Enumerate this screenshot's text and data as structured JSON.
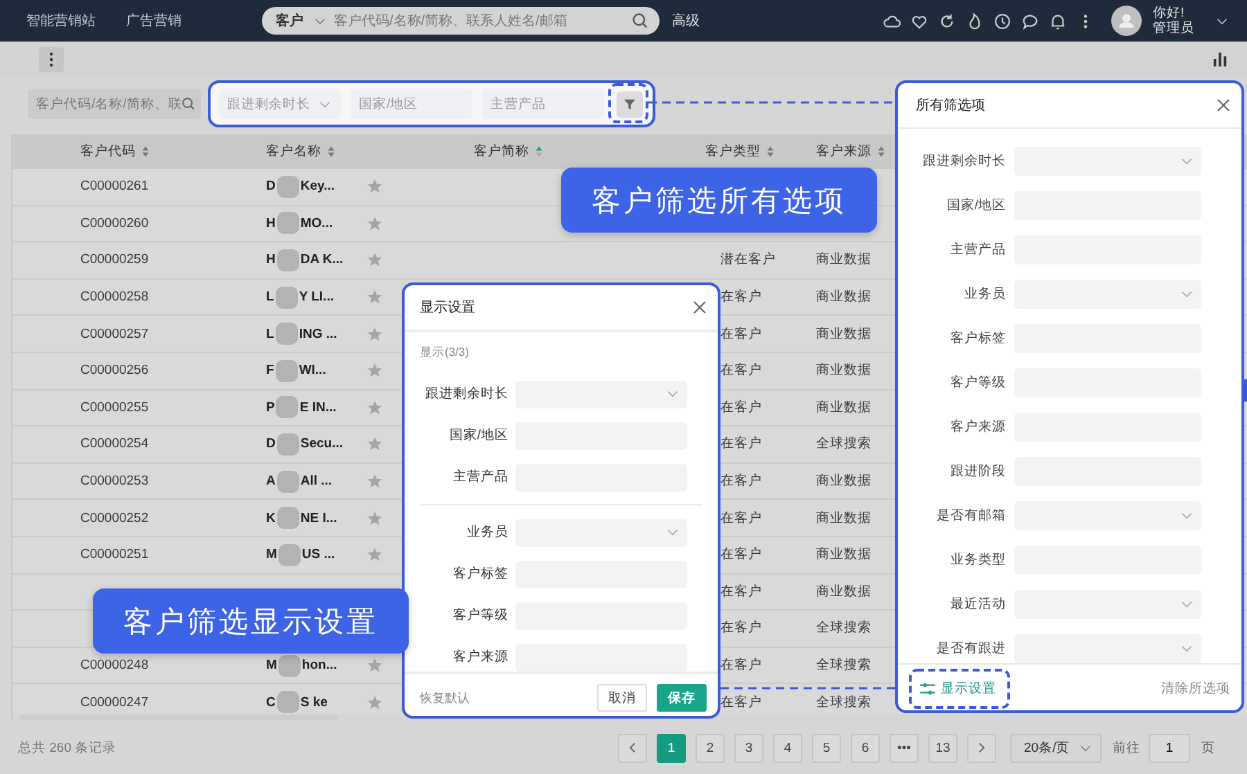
{
  "topbar": {
    "nav": [
      "智能营销站",
      "广告营销"
    ],
    "search": {
      "scope": "客户",
      "placeholder": "客户代码/名称/简称、联系人姓名/邮箱"
    },
    "advanced": "高级",
    "greeting": "你好!",
    "user": "管理员"
  },
  "filter_bar": {
    "search_placeholder": "客户代码/名称/简称、联",
    "filters": [
      {
        "placeholder": "跟进剩余时长",
        "kind": "select"
      },
      {
        "placeholder": "国家/地区",
        "kind": "input"
      },
      {
        "placeholder": "主营产品",
        "kind": "input"
      }
    ]
  },
  "table": {
    "columns": [
      {
        "label": "客户代码",
        "sorted": false
      },
      {
        "label": "客户名称",
        "sorted": false
      },
      {
        "label": "客户简称",
        "sorted": true
      },
      {
        "label": "客户类型",
        "sorted": false
      },
      {
        "label": "客户来源",
        "sorted": false
      }
    ],
    "rows": [
      {
        "code": "C00000261",
        "name_start": "D",
        "name_end": "Key..."
      },
      {
        "code": "C00000260",
        "name_start": "H",
        "name_end": "MO..."
      },
      {
        "code": "C00000259",
        "name_start": "H",
        "name_end": "DA K...",
        "type": "潜在客户",
        "source": "商业数据"
      },
      {
        "code": "C00000258",
        "name_start": "L",
        "name_end": "Y LI...",
        "type": "在客户",
        "source": "商业数据"
      },
      {
        "code": "C00000257",
        "name_start": "L",
        "name_end": "ING ...",
        "type": "在客户",
        "source": "商业数据"
      },
      {
        "code": "C00000256",
        "name_start": "F",
        "name_end": "WI...",
        "type": "在客户",
        "source": "商业数据"
      },
      {
        "code": "C00000255",
        "name_start": "P",
        "name_end": "E IN...",
        "type": "在客户",
        "source": "商业数据"
      },
      {
        "code": "C00000254",
        "name_start": "D",
        "name_end": "Secu...",
        "type": "在客户",
        "source": "全球搜索"
      },
      {
        "code": "C00000253",
        "name_start": "A",
        "name_end": "All ...",
        "type": "在客户",
        "source": "商业数据"
      },
      {
        "code": "C00000252",
        "name_start": "K",
        "name_end": "NE I...",
        "type": "在客户",
        "source": "商业数据"
      },
      {
        "code": "C00000251",
        "name_start": "M",
        "name_end": "US ...",
        "type": "在客户",
        "source": "商业数据"
      },
      {
        "type": "在客户",
        "source": "商业数据"
      },
      {
        "type": "在客户",
        "source": "全球搜索"
      },
      {
        "code": "C00000248",
        "name_start": "M",
        "name_end": "hon...",
        "type": "在客户",
        "source": "全球搜索"
      },
      {
        "code": "C00000247",
        "name_start": "C",
        "name_end": "S ke",
        "type": "在客户",
        "source": "全球搜索"
      }
    ]
  },
  "pagination": {
    "total": "总共 260 条记录",
    "pages": [
      {
        "label": "1",
        "selected": true
      },
      {
        "label": "2",
        "selected": false
      },
      {
        "label": "3",
        "selected": false
      },
      {
        "label": "4",
        "selected": false
      },
      {
        "label": "5",
        "selected": false
      },
      {
        "label": "6",
        "selected": false
      },
      {
        "label": "•••",
        "selected": false
      },
      {
        "label": "13",
        "selected": false
      }
    ],
    "page_size": "20条/页",
    "goto_label": "前往",
    "goto_value": "1",
    "goto_suffix": "页"
  },
  "all_filters_panel": {
    "title": "所有筛选项",
    "fields": [
      {
        "label": "跟进剩余时长",
        "kind": "select"
      },
      {
        "label": "国家/地区",
        "kind": "input"
      },
      {
        "label": "主营产品",
        "kind": "input"
      },
      {
        "label": "业务员",
        "kind": "select"
      },
      {
        "label": "客户标签",
        "kind": "input"
      },
      {
        "label": "客户等级",
        "kind": "input"
      },
      {
        "label": "客户来源",
        "kind": "input"
      },
      {
        "label": "跟进阶段",
        "kind": "input"
      },
      {
        "label": "是否有邮箱",
        "kind": "select"
      },
      {
        "label": "业务类型",
        "kind": "input"
      },
      {
        "label": "最近活动",
        "kind": "select"
      },
      {
        "label": "是否有跟进",
        "kind": "select"
      }
    ],
    "display_settings": "显示设置",
    "clear": "清除所选项"
  },
  "display_dialog": {
    "title": "显示设置",
    "count": "显示(3/3)",
    "shown": [
      {
        "label": "跟进剩余时长",
        "kind": "select"
      },
      {
        "label": "国家/地区",
        "kind": "input"
      },
      {
        "label": "主营产品",
        "kind": "input"
      }
    ],
    "hidden": [
      {
        "label": "业务员",
        "kind": "select"
      },
      {
        "label": "客户标签",
        "kind": "input"
      },
      {
        "label": "客户等级",
        "kind": "input"
      },
      {
        "label": "客户来源",
        "kind": "input"
      }
    ],
    "reset": "恢复默认",
    "cancel": "取消",
    "save": "保存"
  },
  "callouts": [
    "客户筛选所有选项",
    "客户筛选显示设置"
  ]
}
